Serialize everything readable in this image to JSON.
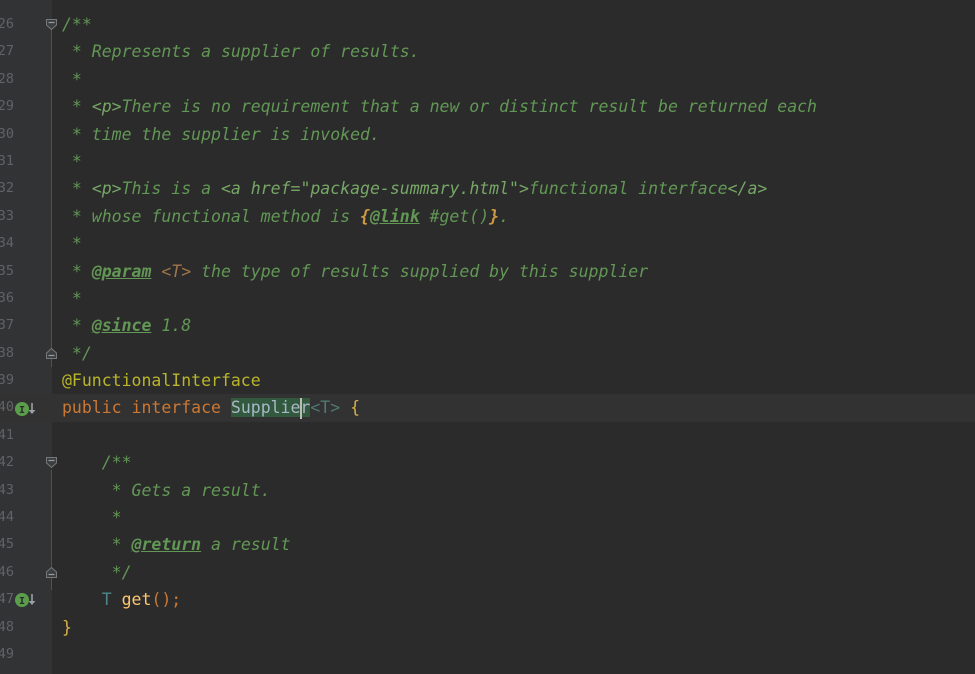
{
  "app": {
    "theme": "darcula",
    "kind": "code-editor",
    "language": "java",
    "file": "Supplier.java"
  },
  "colors": {
    "background": "#2b2b2b",
    "gutter": "#313335",
    "current_line": "#323232",
    "line_number": "#606366",
    "javadoc_text": "#629755",
    "javadoc_html_tag": "#77a767",
    "annotation": "#bbb529",
    "keyword": "#cc7832",
    "identifier": "#a9b7c6",
    "search_highlight": "#32593d",
    "method": "#ffc66d",
    "type_param": "#507874",
    "brace": "#d9b14a",
    "fold_rail": "#4e5254",
    "marker_green": "#5a9e4b"
  },
  "gutter": {
    "markers": [
      {
        "line_index": 14,
        "name": "implemented-methods-marker",
        "glyph": "I",
        "tooltip": "Is implemented in subclasses"
      },
      {
        "line_index": 21,
        "name": "implemented-methods-marker",
        "glyph": "I",
        "tooltip": "Is implemented in subclasses"
      }
    ],
    "folds": [
      {
        "line_index": 0,
        "state": "expanded-start"
      },
      {
        "line_index": 12,
        "state": "expanded-end"
      },
      {
        "line_index": 16,
        "state": "expanded-start"
      },
      {
        "line_index": 20,
        "state": "expanded-end"
      }
    ],
    "line_numbers": [
      "26",
      "27",
      "28",
      "29",
      "30",
      "31",
      "32",
      "33",
      "34",
      "35",
      "36",
      "37",
      "38",
      "39",
      "40",
      "41",
      "42",
      "43",
      "44",
      "45",
      "46",
      "47",
      "48",
      "49"
    ]
  },
  "editor": {
    "current_line_index": 14,
    "caret": {
      "line_index": 14,
      "column": 24
    },
    "lines": [
      {
        "index": 0,
        "text": "/**",
        "tokens": [
          {
            "t": "/**",
            "c": "doc"
          }
        ]
      },
      {
        "index": 1,
        "text": " * Represents a supplier of results.",
        "tokens": [
          {
            "t": " * Represents a supplier of results.",
            "c": "doc"
          }
        ]
      },
      {
        "index": 2,
        "text": " *",
        "tokens": [
          {
            "t": " *",
            "c": "doc"
          }
        ]
      },
      {
        "index": 3,
        "text": " * <p>There is no requirement that a new or distinct result be returned each",
        "tokens": [
          {
            "t": " * ",
            "c": "doc"
          },
          {
            "t": "<p>",
            "c": "doc-html"
          },
          {
            "t": "There is no requirement that a new or distinct result be returned each",
            "c": "doc"
          }
        ]
      },
      {
        "index": 4,
        "text": " * time the supplier is invoked.",
        "tokens": [
          {
            "t": " * time the supplier is invoked.",
            "c": "doc"
          }
        ]
      },
      {
        "index": 5,
        "text": " *",
        "tokens": [
          {
            "t": " *",
            "c": "doc"
          }
        ]
      },
      {
        "index": 6,
        "text": " * <p>This is a <a href=\"package-summary.html\">functional interface</a>",
        "tokens": [
          {
            "t": " * ",
            "c": "doc"
          },
          {
            "t": "<p>",
            "c": "doc-html"
          },
          {
            "t": "This is a ",
            "c": "doc"
          },
          {
            "t": "<a href=\"package-summary.html\">",
            "c": "doc-html"
          },
          {
            "t": "functional interface",
            "c": "doc"
          },
          {
            "t": "</a>",
            "c": "doc-html"
          }
        ]
      },
      {
        "index": 7,
        "text": " * whose functional method is {@link #get()}.",
        "tokens": [
          {
            "t": " * whose functional method is ",
            "c": "doc"
          },
          {
            "t": "{",
            "c": "doc-brace"
          },
          {
            "t": "@link",
            "c": "doc-tag"
          },
          {
            "t": " #get()",
            "c": "doc"
          },
          {
            "t": "}",
            "c": "doc-brace"
          },
          {
            "t": ".",
            "c": "doc"
          }
        ]
      },
      {
        "index": 8,
        "text": " *",
        "tokens": [
          {
            "t": " *",
            "c": "doc"
          }
        ]
      },
      {
        "index": 9,
        "text": " * @param <T> the type of results supplied by this supplier",
        "tokens": [
          {
            "t": " * ",
            "c": "doc"
          },
          {
            "t": "@param",
            "c": "doc-tag"
          },
          {
            "t": " ",
            "c": "doc"
          },
          {
            "t": "<T>",
            "c": "doc-val"
          },
          {
            "t": " the type of results supplied by this supplier",
            "c": "doc"
          }
        ]
      },
      {
        "index": 10,
        "text": " *",
        "tokens": [
          {
            "t": " *",
            "c": "doc"
          }
        ]
      },
      {
        "index": 11,
        "text": " * @since 1.8",
        "tokens": [
          {
            "t": " * ",
            "c": "doc"
          },
          {
            "t": "@since",
            "c": "doc-tag"
          },
          {
            "t": " 1.8",
            "c": "doc"
          }
        ]
      },
      {
        "index": 12,
        "text": " */",
        "tokens": [
          {
            "t": " */",
            "c": "doc"
          }
        ]
      },
      {
        "index": 13,
        "text": "@FunctionalInterface",
        "tokens": [
          {
            "t": "@FunctionalInterface",
            "c": "anno"
          }
        ]
      },
      {
        "index": 14,
        "text": "public interface Supplier<T> {",
        "tokens": [
          {
            "t": "public ",
            "c": "kw"
          },
          {
            "t": "interface ",
            "c": "kw"
          },
          {
            "t": "Supplier",
            "c": "hl"
          },
          {
            "t": "<T>",
            "c": "gen"
          },
          {
            "t": " ",
            "c": "ident"
          },
          {
            "t": "{",
            "c": "brace"
          }
        ]
      },
      {
        "index": 15,
        "text": "",
        "tokens": []
      },
      {
        "index": 16,
        "text": "    /**",
        "tokens": [
          {
            "t": "    /**",
            "c": "doc"
          }
        ]
      },
      {
        "index": 17,
        "text": "     * Gets a result.",
        "tokens": [
          {
            "t": "     * Gets a result.",
            "c": "doc"
          }
        ]
      },
      {
        "index": 18,
        "text": "     *",
        "tokens": [
          {
            "t": "     *",
            "c": "doc"
          }
        ]
      },
      {
        "index": 19,
        "text": "     * @return a result",
        "tokens": [
          {
            "t": "     * ",
            "c": "doc"
          },
          {
            "t": "@return",
            "c": "doc-tag"
          },
          {
            "t": " a result",
            "c": "doc"
          }
        ]
      },
      {
        "index": 20,
        "text": "     */",
        "tokens": [
          {
            "t": "     */",
            "c": "doc"
          }
        ]
      },
      {
        "index": 21,
        "text": "    T get();",
        "tokens": [
          {
            "t": "    ",
            "c": "ident"
          },
          {
            "t": "T",
            "c": "type"
          },
          {
            "t": " ",
            "c": "ident"
          },
          {
            "t": "get",
            "c": "meth"
          },
          {
            "t": "();",
            "c": "punc"
          }
        ]
      },
      {
        "index": 22,
        "text": "}",
        "tokens": [
          {
            "t": "}",
            "c": "brace"
          }
        ]
      },
      {
        "index": 23,
        "text": "",
        "tokens": []
      }
    ]
  }
}
